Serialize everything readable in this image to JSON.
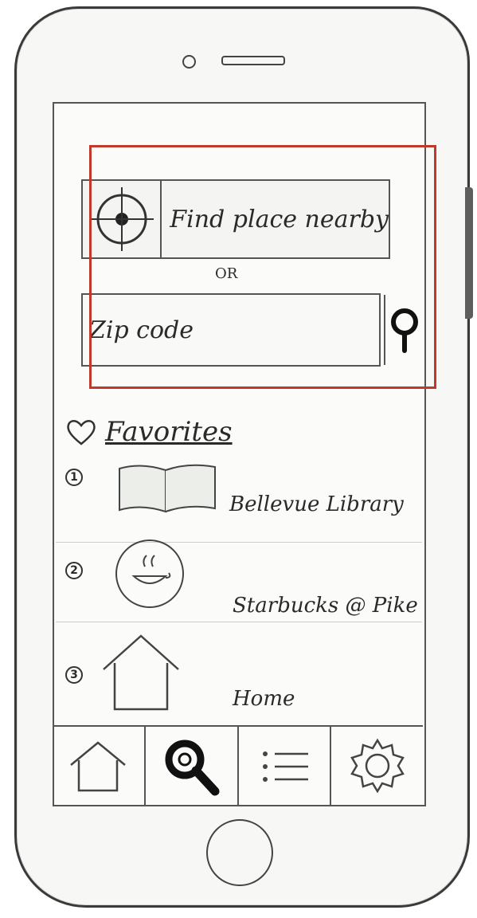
{
  "search": {
    "find_label": "Find place nearby",
    "or_label": "OR",
    "zip_placeholder": "Zip code"
  },
  "favorites": {
    "title": "Favorites",
    "items": [
      {
        "number": "1",
        "name": "Bellevue Library",
        "icon": "book-icon"
      },
      {
        "number": "2",
        "name": "Starbucks @ Pike",
        "icon": "coffee-icon"
      },
      {
        "number": "3",
        "name": "Home",
        "icon": "house-icon"
      }
    ]
  },
  "tabbar": {
    "tabs": [
      {
        "icon": "home-icon",
        "selected": false
      },
      {
        "icon": "search-icon",
        "selected": true
      },
      {
        "icon": "list-icon",
        "selected": false
      },
      {
        "icon": "gear-icon",
        "selected": false
      }
    ]
  },
  "colors": {
    "highlight": "#c0392b",
    "ink": "#2a2a2a"
  }
}
